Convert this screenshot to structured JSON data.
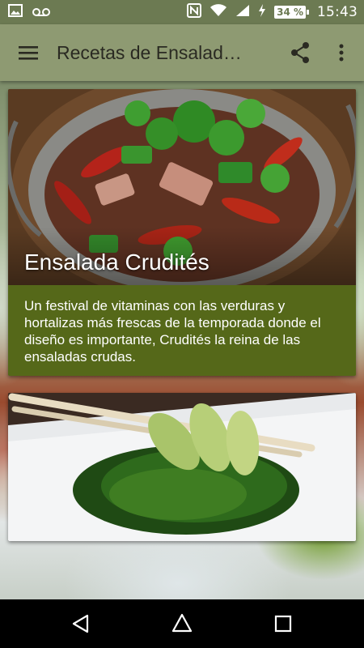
{
  "status_bar": {
    "time": "15:43",
    "battery": "34 %",
    "icons": [
      "image-icon",
      "voicemail-icon",
      "nfc-icon",
      "wifi-icon",
      "signal-icon",
      "charging-icon",
      "battery-icon"
    ]
  },
  "app_bar": {
    "title": "Recetas de Ensalad…",
    "menu_icon": "menu-icon",
    "share_icon": "share-icon",
    "more_icon": "more-vert-icon"
  },
  "cards": [
    {
      "title": "Ensalada Crudités",
      "description": "Un festival de vitaminas con las verduras y hortalizas más frescas de la temporada donde el diseño es importante, Crudités la reina de las ensaladas crudas."
    },
    {
      "title": "",
      "description": ""
    }
  ],
  "nav_bar": {
    "icons": [
      "back-icon",
      "home-icon",
      "recents-icon"
    ]
  },
  "colors": {
    "status_bar": "#6c7a52",
    "app_bar": "#8e9a72",
    "card_caption": "#556819",
    "nav_bar": "#000000"
  }
}
